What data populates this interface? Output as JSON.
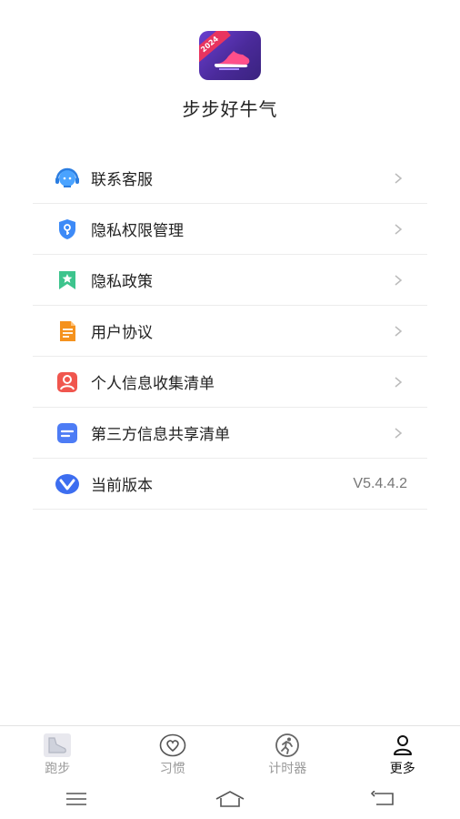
{
  "app": {
    "name": "步步好牛气",
    "logo_badge": "2024"
  },
  "menu": {
    "items": [
      {
        "label": "联系客服",
        "icon": "customer-service-icon"
      },
      {
        "label": "隐私权限管理",
        "icon": "privacy-shield-icon"
      },
      {
        "label": "隐私政策",
        "icon": "bookmark-star-icon"
      },
      {
        "label": "用户协议",
        "icon": "document-icon"
      },
      {
        "label": "个人信息收集清单",
        "icon": "person-card-icon"
      },
      {
        "label": "第三方信息共享清单",
        "icon": "list-card-icon"
      }
    ],
    "version": {
      "label": "当前版本",
      "value": "V5.4.4.2",
      "icon": "version-icon"
    }
  },
  "tabbar": {
    "tabs": [
      {
        "label": "跑步",
        "icon": "shoe-icon",
        "active": false
      },
      {
        "label": "习惯",
        "icon": "heart-icon",
        "active": false
      },
      {
        "label": "计时器",
        "icon": "runner-icon",
        "active": false
      },
      {
        "label": "更多",
        "icon": "profile-icon",
        "active": true
      }
    ]
  },
  "colors": {
    "accent_blue": "#3d8af7",
    "orange": "#f5921e",
    "red": "#f0564e",
    "green": "#3dc48d",
    "inactive_tab": "#9a9a9a",
    "active_tab": "#111111"
  }
}
